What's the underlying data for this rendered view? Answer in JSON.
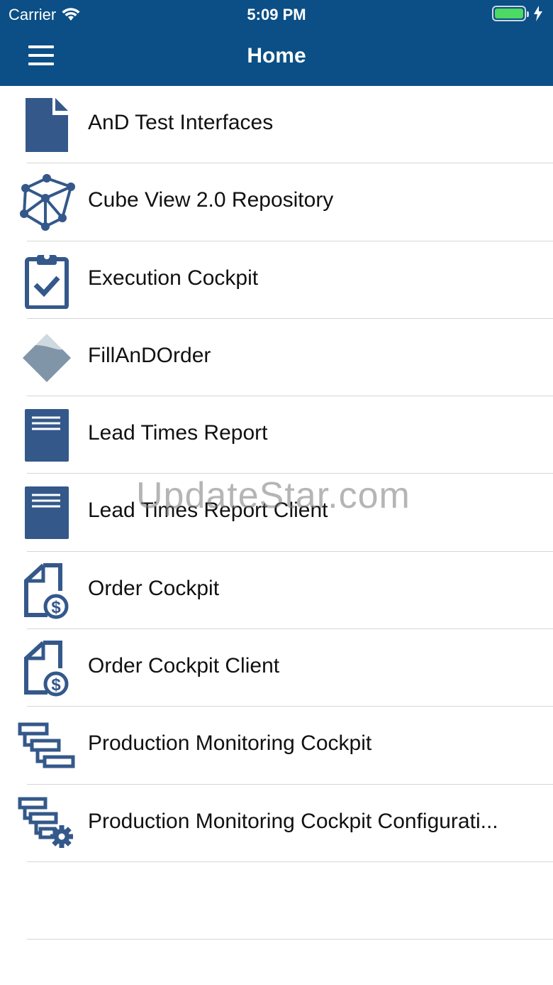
{
  "status_bar": {
    "carrier": "Carrier",
    "time": "5:09 PM",
    "wifi_icon": "wifi-icon",
    "battery_icon": "battery-icon",
    "charging_icon": "bolt-icon"
  },
  "nav": {
    "title": "Home",
    "menu_icon": "hamburger-menu-icon"
  },
  "colors": {
    "header_bg": "#0b4f86",
    "icon_blue": "#34588a",
    "battery_green": "#4cd964"
  },
  "items": [
    {
      "label": "AnD Test Interfaces",
      "icon": "document-icon"
    },
    {
      "label": "Cube View 2.0 Repository",
      "icon": "cube-network-icon"
    },
    {
      "label": "Execution Cockpit",
      "icon": "clipboard-check-icon"
    },
    {
      "label": "FillAnDOrder",
      "icon": "diamond-fill-icon"
    },
    {
      "label": "Lead Times Report",
      "icon": "report-icon"
    },
    {
      "label": "Lead Times Report Client",
      "icon": "report-icon"
    },
    {
      "label": "Order Cockpit",
      "icon": "document-dollar-icon"
    },
    {
      "label": "Order Cockpit Client",
      "icon": "document-dollar-icon"
    },
    {
      "label": "Production Monitoring Cockpit",
      "icon": "hierarchy-icon"
    },
    {
      "label": "Production Monitoring Cockpit Configurati...",
      "icon": "hierarchy-gear-icon"
    }
  ],
  "watermark": "UpdateStar.com"
}
